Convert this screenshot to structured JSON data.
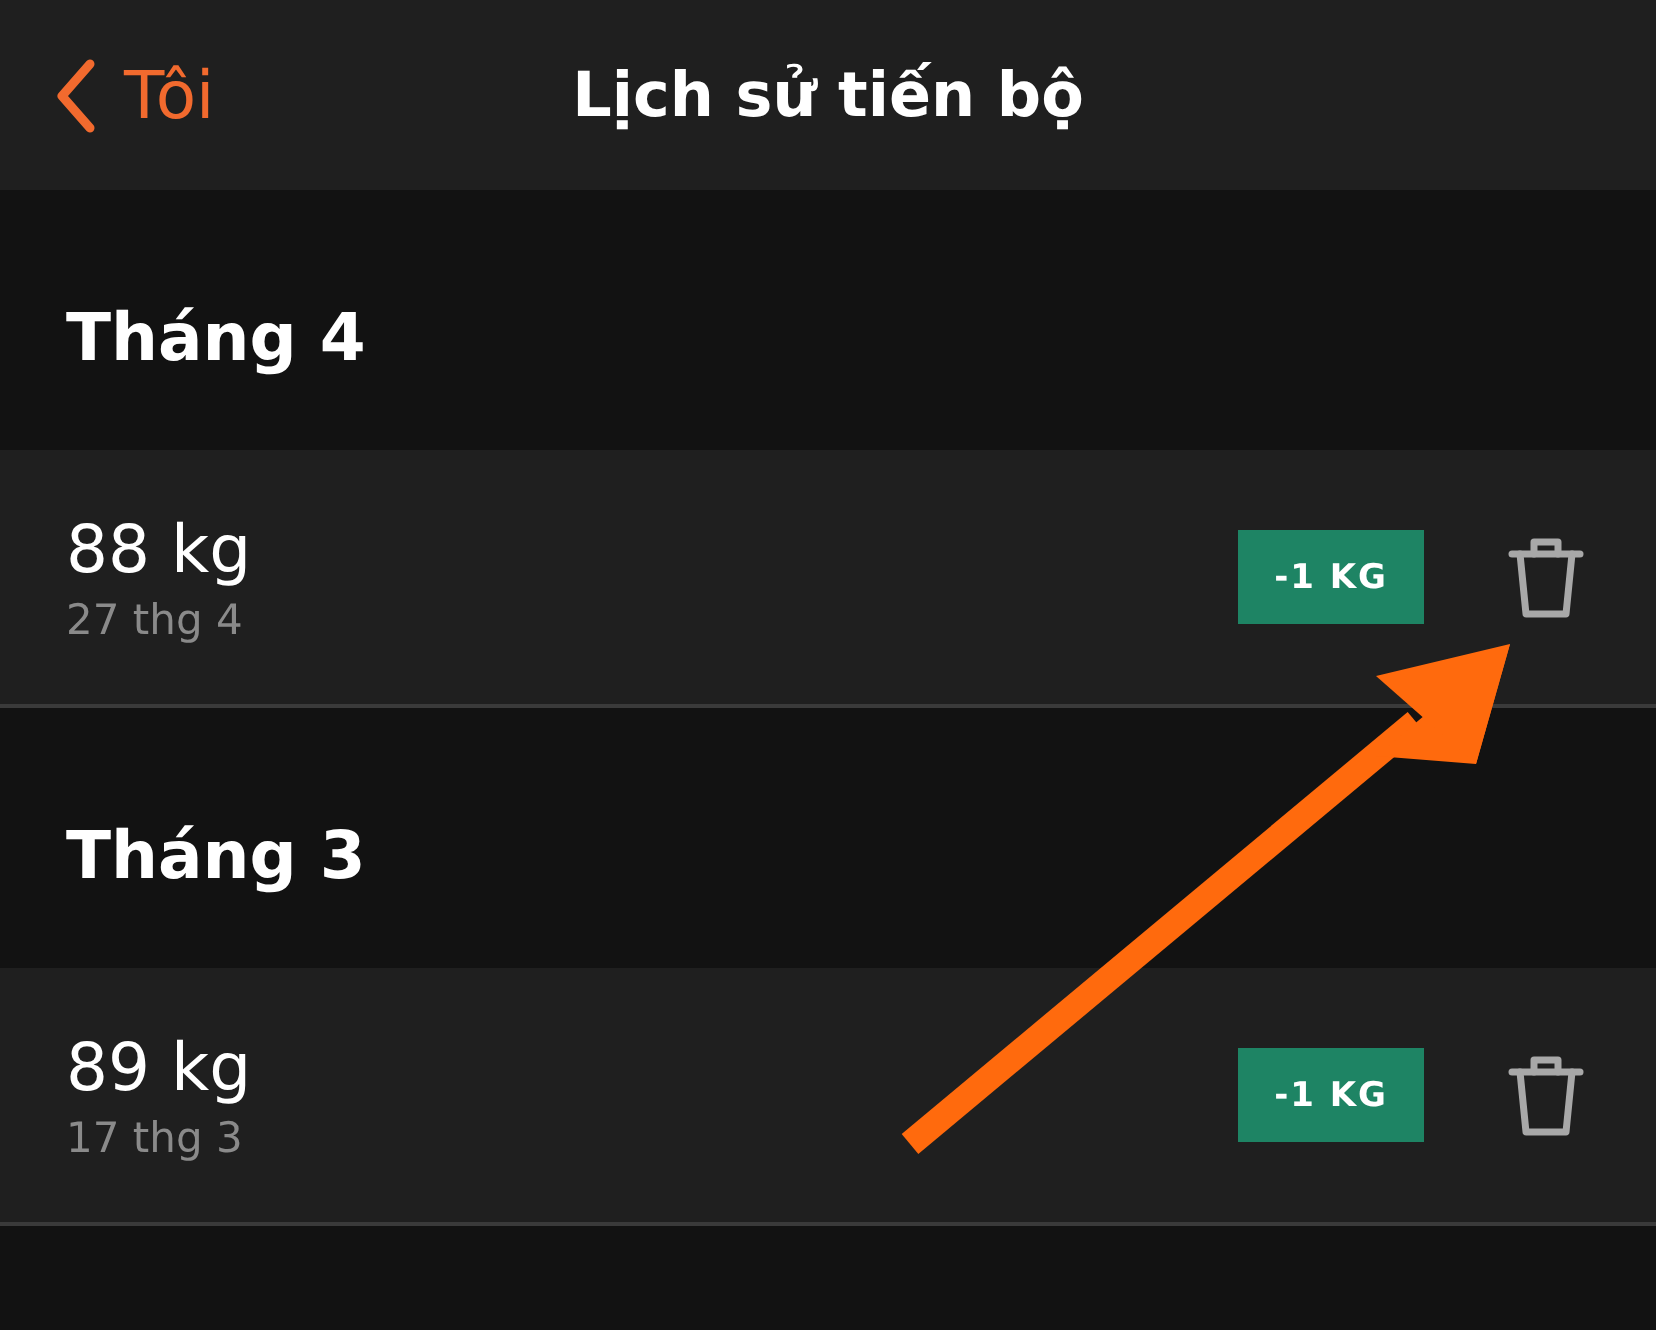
{
  "nav_bar": {
    "back_label": "Tôi",
    "title": "Lịch sử tiến bộ"
  },
  "sections": [
    {
      "title": "Tháng 4",
      "entries": [
        {
          "weight": "88 kg",
          "date": "27 thg 4",
          "change": "-1 KG"
        }
      ]
    },
    {
      "title": "Tháng 3",
      "entries": [
        {
          "weight": "89 kg",
          "date": "17 thg 3",
          "change": "-1 KG"
        }
      ]
    }
  ]
}
